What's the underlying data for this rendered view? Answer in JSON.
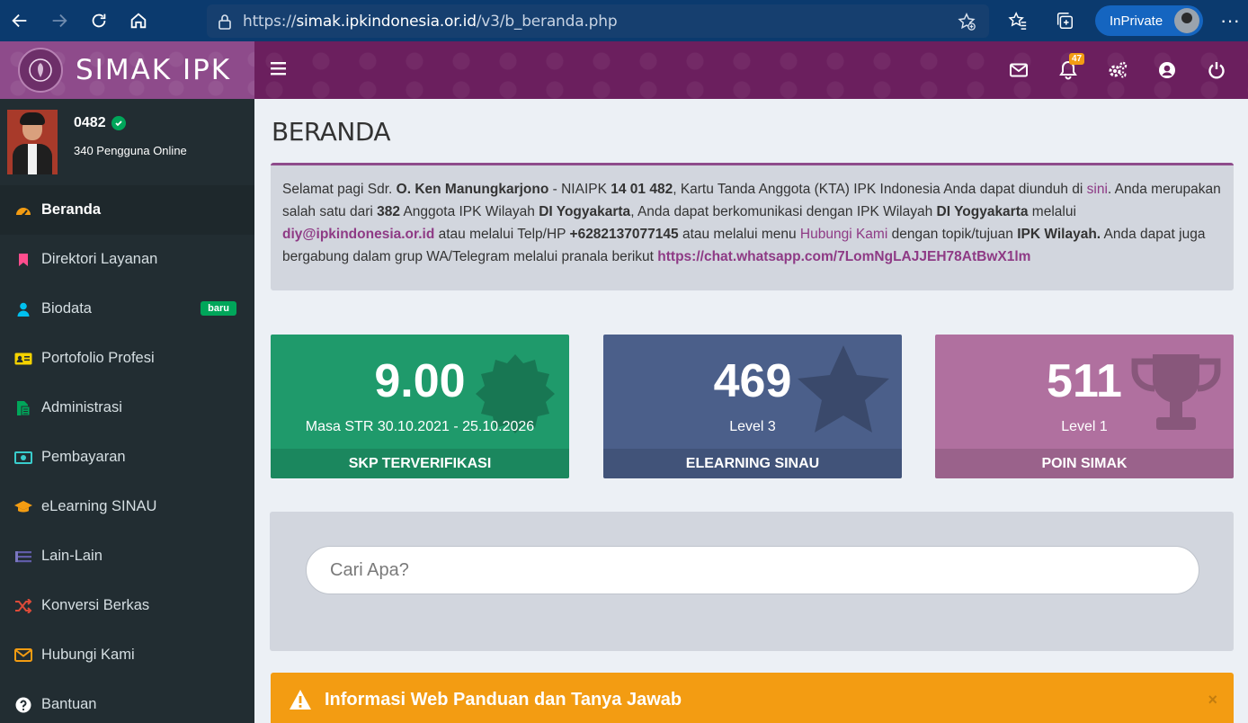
{
  "browser": {
    "url_prefix": "https://",
    "url_host": "simak.ipkindonesia.or.id",
    "url_path": "/v3/b_beranda.php",
    "profile_label": "InPrivate"
  },
  "app": {
    "logo_text": "SIMAK IPK",
    "notification_count": "47"
  },
  "user": {
    "name": "0482",
    "online_text": "340 Pengguna Online"
  },
  "sidebar": {
    "items": [
      {
        "label": "Beranda",
        "icon": "dashboard-icon",
        "color": "#f39c12"
      },
      {
        "label": "Direktori Layanan",
        "icon": "bookmark-icon",
        "color": "#ff4d8d"
      },
      {
        "label": "Biodata",
        "icon": "user-icon",
        "color": "#00c0ef",
        "badge": "baru"
      },
      {
        "label": "Portofolio Profesi",
        "icon": "id-card-icon",
        "color": "#f5d300"
      },
      {
        "label": "Administrasi",
        "icon": "file-icon",
        "color": "#00a65a"
      },
      {
        "label": "Pembayaran",
        "icon": "money-icon",
        "color": "#39cccc"
      },
      {
        "label": "eLearning SINAU",
        "icon": "graduation-cap-icon",
        "color": "#f39c12"
      },
      {
        "label": "Lain-Lain",
        "icon": "list-icon",
        "color": "#605ca8"
      },
      {
        "label": "Konversi Berkas",
        "icon": "random-icon",
        "color": "#dd4b39"
      },
      {
        "label": "Hubungi Kami",
        "icon": "envelope-icon",
        "color": "#f39c12"
      },
      {
        "label": "Bantuan",
        "icon": "question-icon",
        "color": "#ffffff"
      }
    ]
  },
  "main": {
    "title": "BERANDA",
    "welcome": {
      "p1": "Selamat pagi Sdr. ",
      "name": "O. Ken Manungkarjono",
      "p2": " - NIAIPK ",
      "niaipk": "14 01 482",
      "p3": ", Kartu Tanda Anggota (KTA) IPK Indonesia Anda dapat diunduh di ",
      "link_sini": "sini",
      "p4": ". Anda merupakan salah satu dari ",
      "count": "382",
      "p5": " Anggota IPK Wilayah ",
      "region1": "DI Yogyakarta",
      "p6": ", Anda dapat berkomunikasi dengan IPK Wilayah ",
      "region2": "DI Yogyakarta",
      "p7": " melalui ",
      "email": "diy@ipkindonesia.or.id",
      "p8": " atau melalui Telp/HP ",
      "phone": "+6282137077145",
      "p9": " atau melalui menu ",
      "link_hubungi": "Hubungi Kami",
      "p10": " dengan topik/tujuan ",
      "topic": "IPK Wilayah.",
      "p11": " Anda dapat juga bergabung dalam grup WA/Telegram melalui pranala berikut ",
      "chat_link": "https://chat.whatsapp.com/7LomNgLAJJEH78AtBwX1lm"
    },
    "stats": [
      {
        "value": "9.00",
        "sub": "Masa STR 30.10.2021 - 25.10.2026",
        "footer": "SKP TERVERIFIKASI",
        "color": "#1f9a6b",
        "icon": "certificate-icon"
      },
      {
        "value": "469",
        "sub": "Level 3",
        "footer": "ELEARNING SINAU",
        "color": "#4b5f8a",
        "icon": "star-icon"
      },
      {
        "value": "511",
        "sub": "Level 1",
        "footer": "POIN SIMAK",
        "color": "#b0709f",
        "icon": "trophy-icon"
      }
    ],
    "search": {
      "placeholder": "Cari Apa?"
    },
    "alert": {
      "text": "Informasi Web Panduan dan Tanya Jawab",
      "close": "×",
      "color": "#f39c12"
    }
  }
}
